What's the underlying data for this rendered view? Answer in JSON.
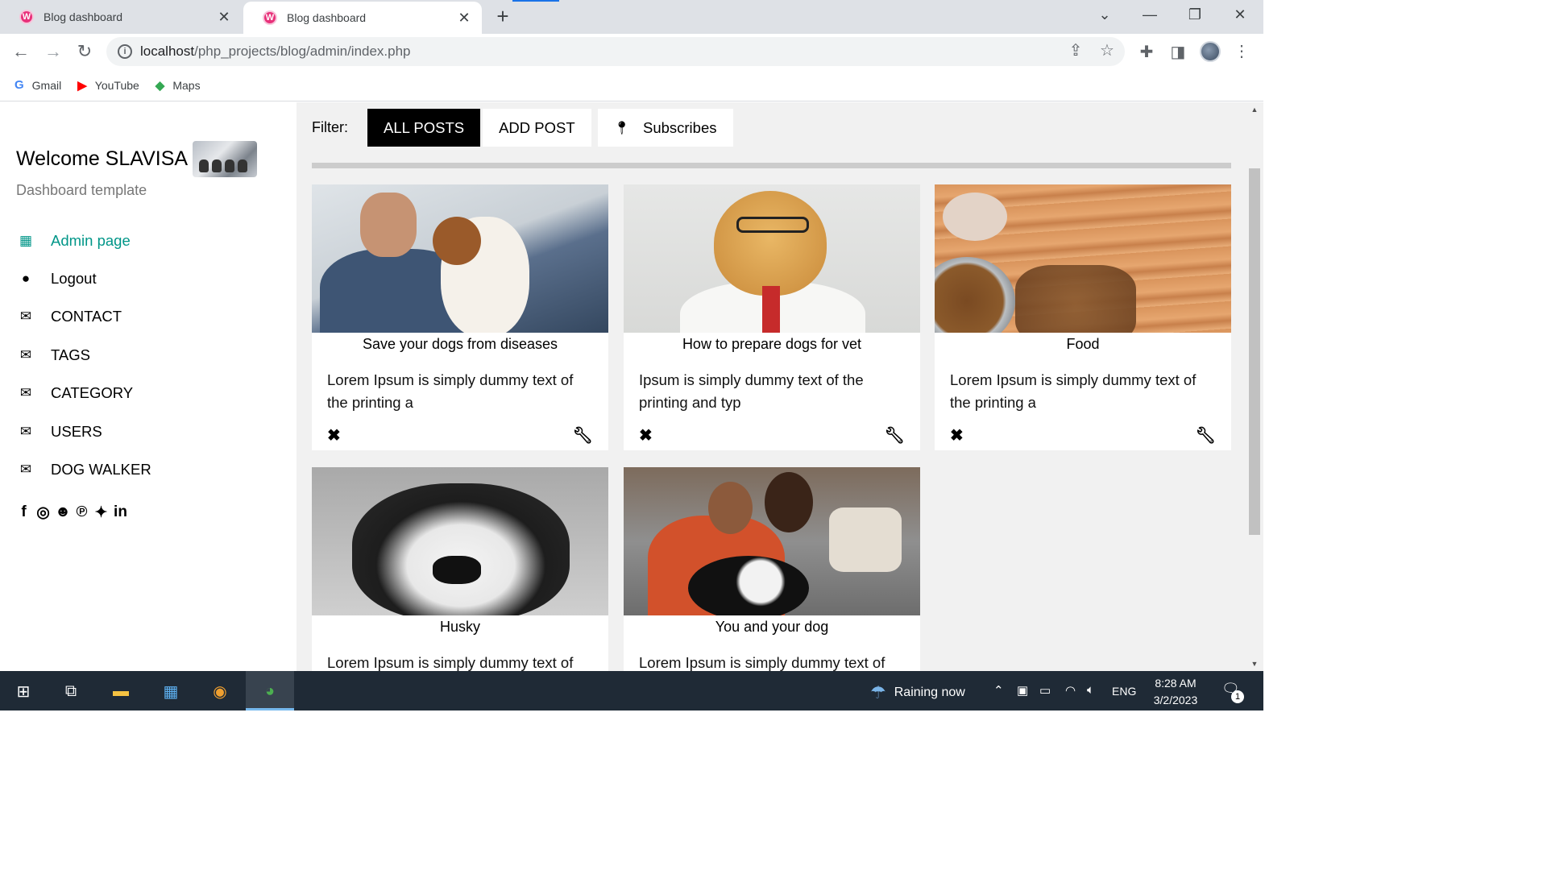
{
  "browser": {
    "tabs": [
      {
        "title": "Blog dashboard",
        "active": false
      },
      {
        "title": "Blog dashboard",
        "active": true
      }
    ],
    "url_host": "localhost",
    "url_path": "/php_projects/blog/admin/index.php",
    "bookmarks": [
      {
        "label": "Gmail",
        "icon": "google-icon",
        "glyph": "G",
        "color": "#4285f4"
      },
      {
        "label": "YouTube",
        "icon": "youtube-icon",
        "glyph": "▶",
        "color": "#ff0000"
      },
      {
        "label": "Maps",
        "icon": "maps-icon",
        "glyph": "◆",
        "color": "#34a853"
      }
    ]
  },
  "sidebar": {
    "welcome": "Welcome SLAVISA",
    "subtitle": "Dashboard template",
    "menu": [
      {
        "label": "Admin page",
        "icon": "dashboard-icon",
        "glyph": "▦",
        "active": true
      },
      {
        "label": "Logout",
        "icon": "user-icon",
        "glyph": "●",
        "active": false
      },
      {
        "label": "CONTACT",
        "icon": "envelope-icon",
        "glyph": "✉",
        "active": false
      },
      {
        "label": "TAGS",
        "icon": "envelope-icon",
        "glyph": "✉",
        "active": false
      },
      {
        "label": "CATEGORY",
        "icon": "envelope-icon",
        "glyph": "✉",
        "active": false
      },
      {
        "label": "USERS",
        "icon": "envelope-icon",
        "glyph": "✉",
        "active": false
      },
      {
        "label": "DOG WALKER",
        "icon": "envelope-icon",
        "glyph": "✉",
        "active": false
      }
    ],
    "socials": [
      "facebook-icon",
      "instagram-icon",
      "snapchat-icon",
      "pinterest-icon",
      "twitter-icon",
      "linkedin-icon"
    ]
  },
  "filter": {
    "label": "Filter:",
    "buttons": [
      "ALL POSTS",
      "ADD POST",
      "Subscribes"
    ],
    "active": "ALL POSTS"
  },
  "posts": [
    {
      "title": "Save your dogs from diseases",
      "desc": "Lorem Ipsum is simply dummy text of the printing a"
    },
    {
      "title": "How to prepare dogs for vet",
      "desc": "Ipsum is simply dummy text of the printing and typ"
    },
    {
      "title": "Food",
      "desc": "Lorem Ipsum is simply dummy text of the printing a"
    },
    {
      "title": "Husky",
      "desc": "Lorem Ipsum is simply dummy text of"
    },
    {
      "title": "You and your dog",
      "desc": "Lorem Ipsum is simply dummy text of"
    }
  ],
  "taskbar": {
    "weather": "Raining now",
    "language": "ENG",
    "time": "8:28 AM",
    "date": "3/2/2023",
    "notifications": "1"
  },
  "colors": {
    "accent": "#009688",
    "active_filter_bg": "#000000",
    "content_bg": "#f1f1f1"
  }
}
